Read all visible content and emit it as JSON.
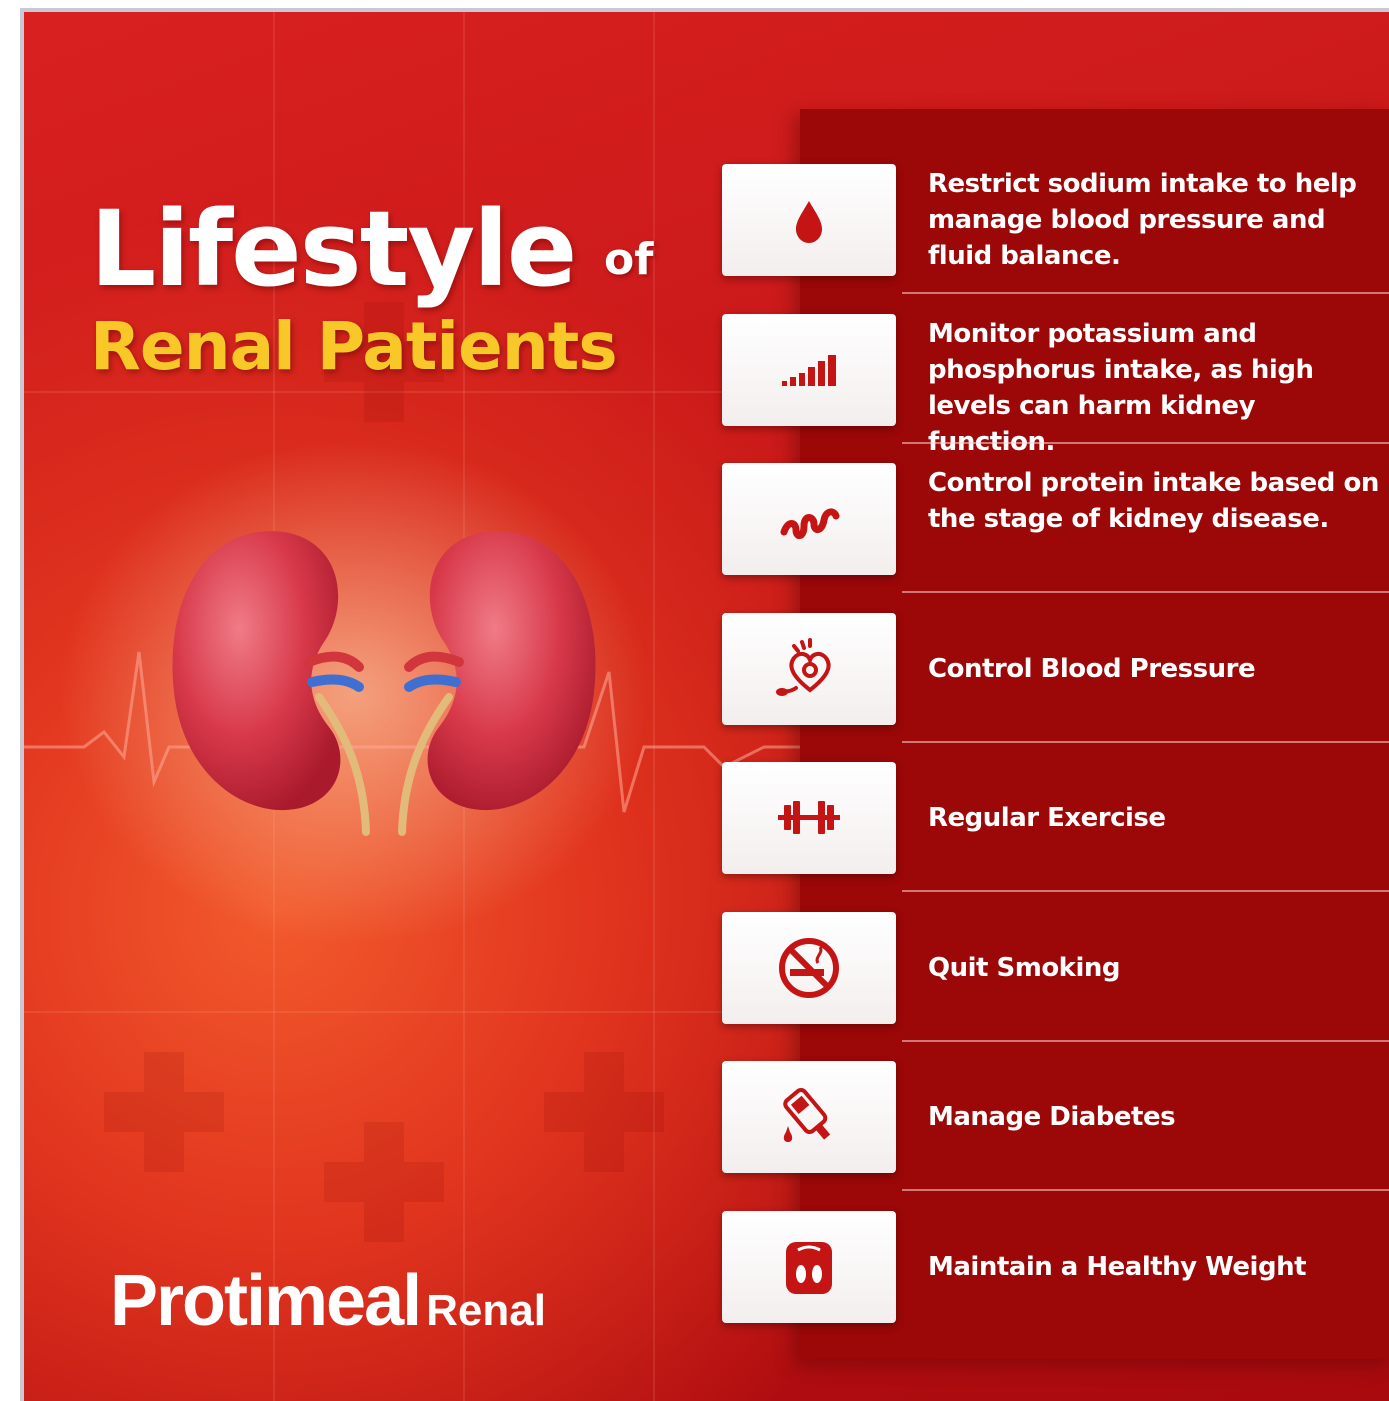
{
  "title": {
    "line1": "Lifestyle",
    "of": "of",
    "line2": "Renal Patients"
  },
  "brand": {
    "name": "Protimeal",
    "suffix": "Renal"
  },
  "colors": {
    "background": "#c81818",
    "panel": "#9c0708",
    "title_accent": "#f7c827",
    "icon": "#c41414"
  },
  "tips": [
    {
      "icon": "blood-drop-icon",
      "text": "Restrict sodium intake to help manage blood pressure and fluid balance."
    },
    {
      "icon": "signal-bars-icon",
      "text": "Monitor potassium and phosphorus intake, as high levels can harm kidney function."
    },
    {
      "icon": "protein-strand-icon",
      "text": "Control protein intake based on the stage of kidney disease."
    },
    {
      "icon": "heart-pressure-icon",
      "text": "Control Blood Pressure"
    },
    {
      "icon": "dumbbell-icon",
      "text": "Regular Exercise"
    },
    {
      "icon": "no-smoking-icon",
      "text": "Quit Smoking"
    },
    {
      "icon": "glucometer-icon",
      "text": "Manage Diabetes"
    },
    {
      "icon": "weight-scale-icon",
      "text": "Maintain a Healthy Weight"
    }
  ]
}
